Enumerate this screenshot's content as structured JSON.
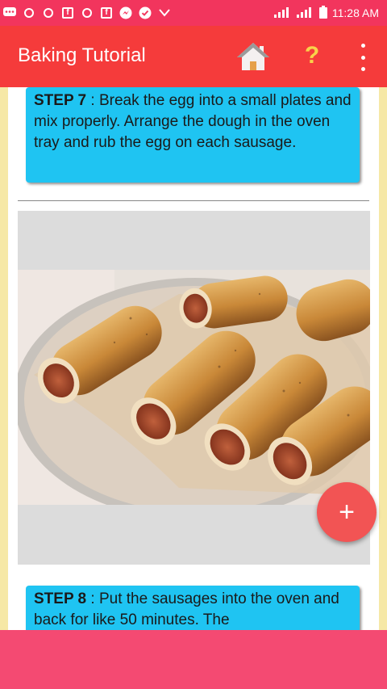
{
  "status_bar": {
    "time": "11:28 AM",
    "icons": [
      "chat-bubble-icon",
      "circle-icon",
      "circle-icon",
      "facebook-icon",
      "circle-icon",
      "facebook-icon",
      "messenger-icon",
      "check-circle-icon",
      "chevron-icon",
      "signal-icon",
      "signal-icon",
      "battery-icon"
    ]
  },
  "app_bar": {
    "title": "Baking Tutorial",
    "help_label": "?",
    "background": "#f53b3b"
  },
  "steps": [
    {
      "label": "STEP 7",
      "separator": " : ",
      "text": "Break the egg into a small plates and mix properly. Arrange the dough in the oven tray and rub the egg on each sausage."
    },
    {
      "label": "STEP 8",
      "separator": " : ",
      "text": "Put the sausages into the oven and back for like 50 minutes. The"
    }
  ],
  "fab": {
    "label": "+"
  },
  "colors": {
    "status_bar": "#f2355d",
    "card": "#1fc4f2",
    "fab": "#f25454",
    "bottom_bar": "#f44a72",
    "side_frame": "#f6e8a6"
  }
}
